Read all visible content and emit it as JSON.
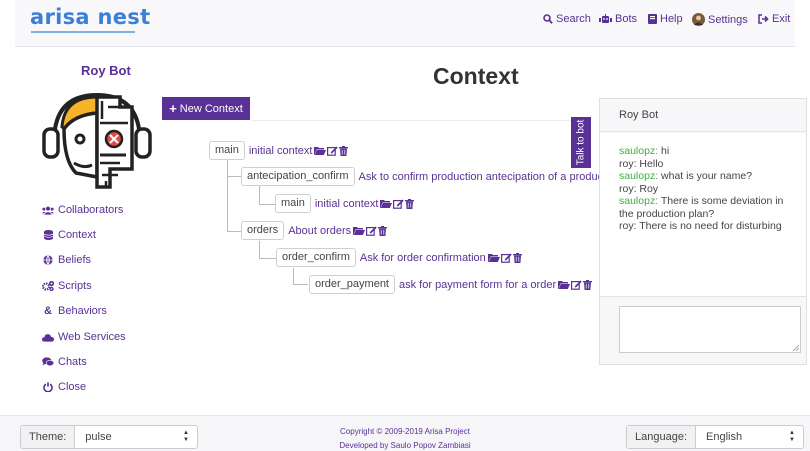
{
  "navbar": {
    "brand": "arisa nest",
    "items": [
      {
        "label": "Search",
        "icon": "search-icon"
      },
      {
        "label": "Bots",
        "icon": "bots-icon"
      },
      {
        "label": "Help",
        "icon": "book-icon"
      },
      {
        "label": "Settings",
        "icon": "user-avatar-icon"
      },
      {
        "label": "Exit",
        "icon": "sign-out-icon"
      }
    ]
  },
  "sidebar": {
    "bot_name": "Roy Bot",
    "items": [
      {
        "label": "Collaborators",
        "icon": "users-icon"
      },
      {
        "label": "Context",
        "icon": "database-icon"
      },
      {
        "label": "Beliefs",
        "icon": "globe-icon"
      },
      {
        "label": "Scripts",
        "icon": "cogs-icon"
      },
      {
        "label": "Behaviors",
        "icon": "ampersand-icon"
      },
      {
        "label": "Web Services",
        "icon": "cloud-icon"
      },
      {
        "label": "Chats",
        "icon": "comments-icon"
      },
      {
        "label": "Close",
        "icon": "power-icon"
      }
    ]
  },
  "main": {
    "title": "Context",
    "new_button": "New Context",
    "tree": [
      {
        "name": "main",
        "description": "initial context"
      },
      {
        "name": "antecipation_confirm",
        "description": "Ask to confirm production antecipation of a product"
      },
      {
        "name": "main",
        "description": "initial context"
      },
      {
        "name": "orders",
        "description": "About orders"
      },
      {
        "name": "order_confirm",
        "description": "Ask for order confirmation"
      },
      {
        "name": "order_payment",
        "description": "ask for payment form for a order"
      }
    ]
  },
  "talk_tab": "Talk to bot",
  "chat": {
    "title": "Roy Bot",
    "messages": [
      {
        "speaker": "saulopz:",
        "text": " hi",
        "type": "user"
      },
      {
        "speaker": "roy:",
        "text": " Hello",
        "type": "bot"
      },
      {
        "speaker": "saulopz:",
        "text": " what is your name?",
        "type": "user"
      },
      {
        "speaker": "roy:",
        "text": " Roy",
        "type": "bot"
      },
      {
        "speaker": "saulopz:",
        "text": " There is some deviation in the production plan?",
        "type": "user"
      },
      {
        "speaker": "roy:",
        "text": " There is no need for disturbing",
        "type": "bot"
      }
    ],
    "input_value": ""
  },
  "footer": {
    "theme_label": "Theme:",
    "theme_value": "pulse",
    "language_label": "Language:",
    "language_value": "English",
    "copyright_line1": "Copyright © 2009-2019 Arisa Project",
    "copyright_line2": "Developed by Saulo Popov Zambiasi"
  },
  "colors": {
    "accent": "#593196",
    "brand": "#3d7fd6",
    "user_name": "#3fae3f"
  }
}
